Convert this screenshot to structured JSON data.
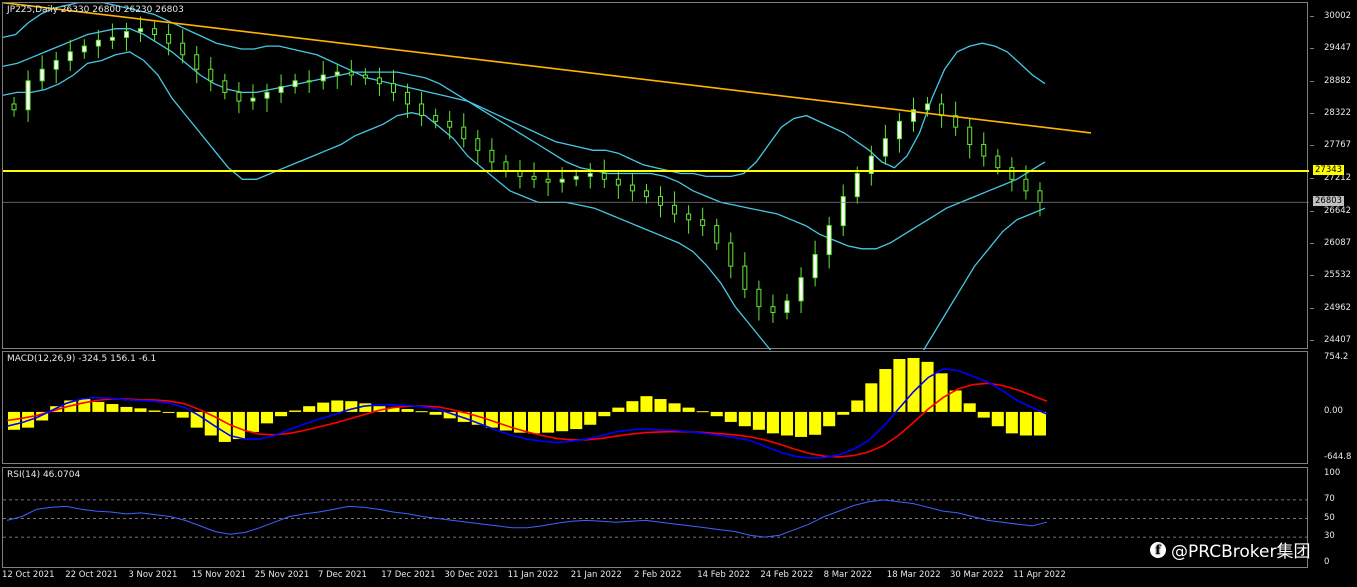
{
  "main": {
    "title": "JP225,Daily  26330 26800 26230 26803",
    "y_labels": [
      "30002",
      "29447",
      "28882",
      "28322",
      "27767",
      "27212",
      "26642",
      "26087",
      "25532",
      "24962",
      "24407"
    ],
    "y_min": 24407,
    "y_max": 30002,
    "horizontal_level": {
      "value": 27343,
      "label": "27343",
      "color": "#ffff00"
    },
    "current_price": {
      "value": 26803,
      "label": "26803",
      "color": "#c0c0c0"
    },
    "trendline_color": "#ffb400",
    "trendline": {
      "from": [
        0,
        30250
      ],
      "to": [
        178,
        28000
      ]
    },
    "band_color": "#46c8e6",
    "candle_color": "#ffffff",
    "wick_color": "#64e632",
    "bollinger_upper": [
      29650,
      29700,
      29900,
      30050,
      30150,
      30200,
      30250,
      30250,
      30250,
      30200,
      30150,
      30100,
      30050,
      29950,
      29850,
      29750,
      29650,
      29550,
      29500,
      29450,
      29450,
      29500,
      29500,
      29450,
      29400,
      29350,
      29250,
      29150,
      29050,
      28950,
      28900,
      28850,
      28800,
      28750,
      28700,
      28650,
      28600,
      28550,
      28450,
      28350,
      28250,
      28150,
      28050,
      27950,
      27850,
      27800,
      27750,
      27700,
      27700,
      27650,
      27550,
      27450,
      27400,
      27350,
      27300,
      27300,
      27250,
      27250,
      27250,
      27300,
      27500,
      27800,
      28100,
      28250,
      28300,
      28200,
      28100,
      28000,
      27850,
      27700,
      27500,
      27400,
      27600,
      28000,
      28600,
      29100,
      29400,
      29500,
      29550,
      29500,
      29400,
      29200,
      29000,
      28850
    ],
    "bollinger_middle": [
      29150,
      29200,
      29300,
      29400,
      29500,
      29600,
      29700,
      29750,
      29800,
      29800,
      29700,
      29550,
      29400,
      29200,
      29000,
      28850,
      28750,
      28700,
      28700,
      28750,
      28800,
      28850,
      28900,
      28950,
      29000,
      29050,
      29050,
      29050,
      29050,
      29000,
      28950,
      28850,
      28700,
      28550,
      28400,
      28250,
      28100,
      27950,
      27800,
      27650,
      27500,
      27400,
      27350,
      27300,
      27300,
      27300,
      27300,
      27250,
      27150,
      27000,
      26900,
      26800,
      26750,
      26700,
      26650,
      26600,
      26500,
      26400,
      26250,
      26150,
      26050,
      26000,
      26000,
      26100,
      26250,
      26400,
      26550,
      26700,
      26800,
      26900,
      27000,
      27100,
      27200,
      27350,
      27500
    ],
    "bollinger_lower": [
      28650,
      28700,
      28700,
      28750,
      28850,
      29000,
      29200,
      29250,
      29350,
      29400,
      29250,
      29000,
      28600,
      28300,
      28000,
      27700,
      27400,
      27200,
      27200,
      27300,
      27400,
      27500,
      27600,
      27700,
      27800,
      27950,
      28050,
      28150,
      28300,
      28350,
      28300,
      28100,
      27900,
      27600,
      27400,
      27200,
      27000,
      26900,
      26800,
      26800,
      26800,
      26750,
      26700,
      26600,
      26500,
      26400,
      26300,
      26200,
      26100,
      25950,
      25700,
      25400,
      25000,
      24700,
      24400,
      24100,
      23900,
      23700,
      23600,
      23500,
      23450,
      23450,
      23500,
      23600,
      23800,
      24100,
      24500,
      24900,
      25300,
      25700,
      26000,
      26300,
      26500,
      26600,
      26700
    ],
    "close_series": [
      28400,
      28900,
      29100,
      29250,
      29400,
      29500,
      29600,
      29650,
      29750,
      29800,
      29700,
      29550,
      29350,
      29100,
      28900,
      28700,
      28550,
      28600,
      28700,
      28800,
      28900,
      28900,
      29000,
      29050,
      29000,
      28950,
      28850,
      28700,
      28500,
      28300,
      28200,
      28100,
      27900,
      27700,
      27500,
      27350,
      27250,
      27200,
      27150,
      27200,
      27250,
      27300,
      27200,
      27100,
      27000,
      26900,
      26750,
      26600,
      26500,
      26400,
      26100,
      25700,
      25300,
      25000,
      24900,
      25100,
      25500,
      25900,
      26400,
      26900,
      27300,
      27600,
      27900,
      28200,
      28400,
      28500,
      28300,
      28100,
      27800,
      27600,
      27400,
      27200,
      27000,
      26800
    ]
  },
  "macd": {
    "title": "MACD(12,26,9) -324.5 156.1 -6.1",
    "y_labels": [
      "754.2",
      "0.00",
      "-644.8"
    ],
    "y_min": -644.8,
    "y_max": 754.2,
    "histogram_color": "#ffff00",
    "main_line_color": "#0000ff",
    "signal_line_color": "#ff0000",
    "histogram": [
      -250,
      -220,
      -120,
      80,
      160,
      180,
      140,
      110,
      70,
      50,
      20,
      0,
      -80,
      -220,
      -330,
      -420,
      -380,
      -280,
      -160,
      -60,
      20,
      80,
      130,
      160,
      150,
      120,
      80,
      60,
      40,
      10,
      -40,
      -90,
      -140,
      -180,
      -220,
      -260,
      -290,
      -300,
      -290,
      -270,
      -240,
      -180,
      -60,
      60,
      150,
      220,
      180,
      120,
      60,
      10,
      -60,
      -140,
      -200,
      -250,
      -300,
      -330,
      -350,
      -320,
      -200,
      -40,
      160,
      400,
      600,
      740,
      754,
      700,
      540,
      300,
      120,
      -80,
      -200,
      -300,
      -330,
      -330
    ],
    "main_line": [
      -200,
      -150,
      -80,
      20,
      120,
      180,
      200,
      190,
      170,
      160,
      150,
      120,
      60,
      -60,
      -200,
      -330,
      -380,
      -380,
      -330,
      -250,
      -170,
      -100,
      -40,
      30,
      80,
      100,
      100,
      90,
      70,
      40,
      -30,
      -100,
      -180,
      -260,
      -330,
      -380,
      -410,
      -430,
      -410,
      -380,
      -330,
      -280,
      -250,
      -240,
      -250,
      -260,
      -280,
      -300,
      -330,
      -360,
      -400,
      -480,
      -560,
      -620,
      -645,
      -640,
      -600,
      -520,
      -400,
      -200,
      40,
      280,
      480,
      600,
      580,
      500,
      420,
      300,
      160,
      60,
      -30
    ],
    "signal_line": [
      -120,
      -90,
      -50,
      10,
      70,
      120,
      160,
      180,
      180,
      170,
      165,
      150,
      110,
      30,
      -70,
      -180,
      -260,
      -310,
      -320,
      -300,
      -260,
      -210,
      -160,
      -100,
      -40,
      20,
      60,
      80,
      80,
      70,
      30,
      -20,
      -80,
      -150,
      -220,
      -280,
      -330,
      -370,
      -390,
      -390,
      -370,
      -340,
      -310,
      -290,
      -280,
      -275,
      -280,
      -290,
      -305,
      -320,
      -350,
      -390,
      -450,
      -520,
      -580,
      -620,
      -630,
      -610,
      -560,
      -470,
      -330,
      -150,
      40,
      200,
      320,
      380,
      400,
      370,
      310,
      230,
      150
    ]
  },
  "rsi": {
    "title": "RSI(14) 46.0704",
    "y_labels": [
      "100",
      "70",
      "50",
      "30",
      "0"
    ],
    "levels": [
      70,
      30
    ],
    "line_color": "#3c64ff",
    "values": [
      48,
      52,
      60,
      62,
      63,
      60,
      58,
      57,
      55,
      56,
      54,
      52,
      48,
      42,
      36,
      33,
      35,
      40,
      46,
      52,
      55,
      57,
      60,
      63,
      62,
      60,
      57,
      55,
      52,
      50,
      48,
      46,
      44,
      42,
      40,
      40,
      42,
      45,
      47,
      48,
      47,
      46,
      47,
      48,
      46,
      44,
      42,
      40,
      38,
      36,
      32,
      30,
      32,
      38,
      44,
      52,
      58,
      64,
      68,
      70,
      68,
      66,
      62,
      58,
      56,
      52,
      48,
      46,
      44,
      42,
      46
    ]
  },
  "x_labels": [
    "12 Oct 2021",
    "22 Oct 2021",
    "3 Nov 2021",
    "15 Nov 2021",
    "25 Nov 2021",
    "7 Dec 2021",
    "17 Dec 2021",
    "30 Dec 2021",
    "11 Jan 2022",
    "21 Jan 2022",
    "2 Feb 2022",
    "14 Feb 2022",
    "24 Feb 2022",
    "8 Mar 2022",
    "18 Mar 2022",
    "30 Mar 2022",
    "11 Apr 2022"
  ],
  "watermark": {
    "icon": "facebook-icon",
    "text": "@PRCBroker集团"
  }
}
